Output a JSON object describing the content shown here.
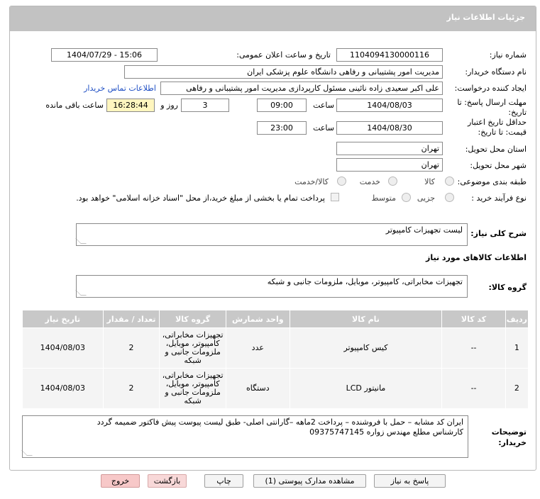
{
  "header": {
    "title": "جزئیات اطلاعات نیاز"
  },
  "watermark": {
    "text": "AriaTender.neT"
  },
  "form": {
    "need_number_label": "شماره نیاز:",
    "need_number": "1104094130000116",
    "announce_label": "تاریخ و ساعت اعلان عمومی:",
    "announce_value": "1404/07/29 - 15:06",
    "buyer_org_label": "نام دستگاه خریدار:",
    "buyer_org": "مدیریت امور پشتیبانی و رفاهی دانشگاه علوم پزشکی ایران",
    "creator_label": "ایجاد کننده درخواست:",
    "creator": "علی اکبر سعیدی زاده نائینی مسئول کارپردازی مدیریت امور پشتیبانی و رفاهی",
    "contact_link": "اطلاعات تماس خریدار",
    "reply_deadline_label_1": "مهلت ارسال پاسخ: تا",
    "reply_deadline_label_2": "تاریخ:",
    "reply_date": "1404/08/03",
    "time_label": "ساعت",
    "reply_time": "09:00",
    "days_value": "3",
    "days_label": "روز و",
    "remaining_time": "16:28:44",
    "remaining_label": "ساعت باقی مانده",
    "price_validity_label_1": "حداقل تاریخ اعتبار",
    "price_validity_label_2": "قیمت: تا تاریخ:",
    "validity_date": "1404/08/30",
    "validity_time": "23:00",
    "province_label": "استان محل تحویل:",
    "province": "تهران",
    "city_label": "شهر محل تحویل:",
    "city": "تهران",
    "category_label": "طبقه بندی موضوعی:",
    "category_options": [
      "کالا",
      "خدمت",
      "کالا/خدمت"
    ],
    "process_label": "نوع فرآیند خرید :",
    "process_options": [
      "جزیی",
      "متوسط"
    ],
    "payment_note": "پرداخت تمام یا بخشی از مبلغ خرید،از محل \"اسناد خزانه اسلامی\" خواهد بود."
  },
  "summary": {
    "label": "شرح کلی نیاز:",
    "value": "لیست تجهیزات کامپیوتر"
  },
  "goods_info": {
    "title": "اطلاعات کالاهای مورد نیاز",
    "group_label": "گروه کالا:",
    "group_value": "تجهیزات مخابراتی، کامپیوتر، موبایل، ملزومات جانبی و شبکه"
  },
  "table": {
    "headers": [
      "ردیف",
      "کد کالا",
      "نام کالا",
      "واحد شمارش",
      "گروه کالا",
      "تعداد / مقدار",
      "تاریخ نیاز"
    ],
    "rows": [
      {
        "row": "1",
        "code": "--",
        "name": "کیس کامپیوتر",
        "unit": "عدد",
        "group_lines": [
          "تجهیزات مخابراتی،",
          "کامپیوتر، موبایل،",
          "ملزومات جانبی و",
          "شبکه"
        ],
        "qty": "2",
        "date": "1404/08/03"
      },
      {
        "row": "2",
        "code": "--",
        "name": "مانیتور LCD",
        "unit": "دستگاه",
        "group_lines": [
          "تجهیزات مخابراتی،",
          "کامپیوتر، موبایل،",
          "ملزومات جانبی و",
          "شبکه"
        ],
        "qty": "2",
        "date": "1404/08/03"
      }
    ]
  },
  "notes": {
    "label_1": "توضیحات",
    "label_2": "خریدار:",
    "line_1": "ایران کد مشابه – حمل با فروشنده – پرداخت 2ماهه –گارانتی اصلی- طبق لیست پیوست پیش فاکتور ضمیمه گردد",
    "line_2": "کارشناس مطلع مهندس زواره 09375747145"
  },
  "buttons": {
    "reply": "پاسخ به نیاز",
    "docs": "مشاهده مدارک پیوستی (1)",
    "print": "چاپ",
    "back": "بازگشت",
    "exit": "خروج"
  },
  "colors": {
    "titlebar": "#c2c2c2",
    "link": "#1f4fc4",
    "remaining_bg": "#fff6bf",
    "exit_bg": "#f7c8c8"
  }
}
